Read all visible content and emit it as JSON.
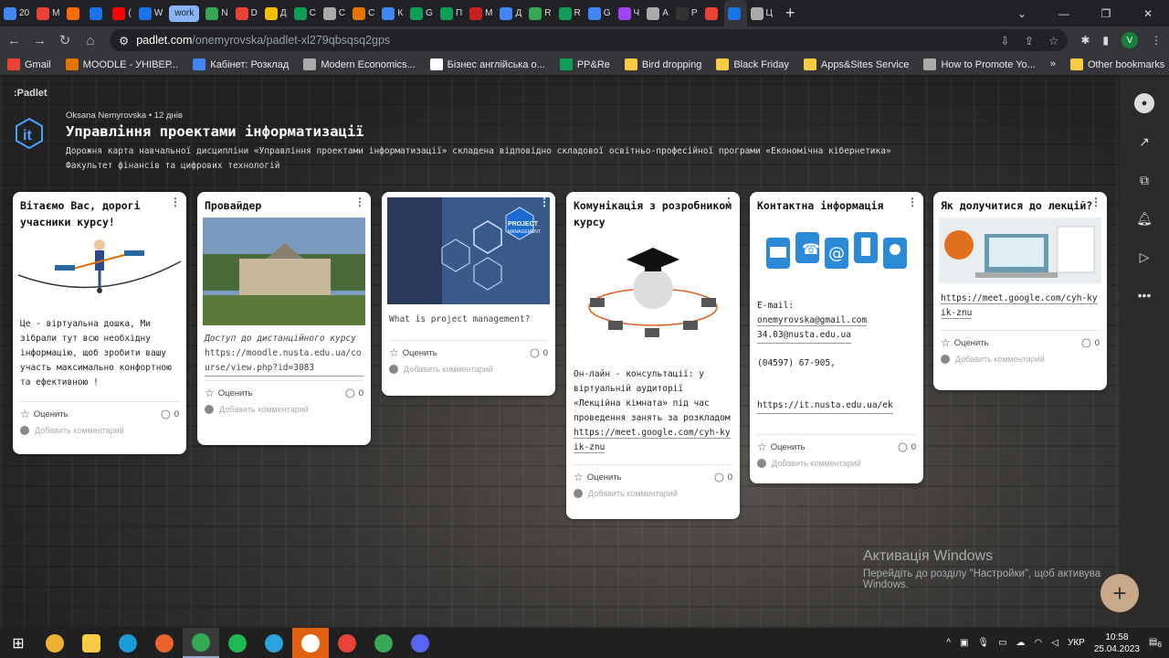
{
  "browser": {
    "tabs": [
      {
        "label": "20",
        "color": "#4285f4"
      },
      {
        "label": "M",
        "color": "#ea4335"
      },
      {
        "label": "",
        "color": "#ff6d00"
      },
      {
        "label": "",
        "color": "#1a73e8"
      },
      {
        "label": "(",
        "color": "#ff0000"
      },
      {
        "label": "W",
        "color": "#1a73e8"
      },
      {
        "label": "work",
        "color": "#8ab4f8"
      },
      {
        "label": "N",
        "color": "#34a853"
      },
      {
        "label": "D",
        "color": "#ea4335"
      },
      {
        "label": "Д",
        "color": "#fbbc04"
      },
      {
        "label": "С",
        "color": "#0f9d58"
      },
      {
        "label": "С",
        "color": "#aaaaaa"
      },
      {
        "label": "С",
        "color": "#e37400"
      },
      {
        "label": "К",
        "color": "#4285f4"
      },
      {
        "label": "G",
        "color": "#0f9d58"
      },
      {
        "label": "П",
        "color": "#0f9d58"
      },
      {
        "label": "М",
        "color": "#c5221f"
      },
      {
        "label": "Д",
        "color": "#4285f4"
      },
      {
        "label": "R",
        "color": "#34a853"
      },
      {
        "label": "R",
        "color": "#0f9d58"
      },
      {
        "label": "G",
        "color": "#4285f4"
      },
      {
        "label": "Ч",
        "color": "#a142f4"
      },
      {
        "label": "А",
        "color": "#aaaaaa"
      },
      {
        "label": "Р",
        "color": "#333333"
      },
      {
        "label": "",
        "color": "#ea4335"
      },
      {
        "label": "",
        "color": "#1a73e8"
      },
      {
        "label": "Ц",
        "color": "#aaaaaa"
      }
    ],
    "url_host": "padlet.com",
    "url_path": "/onemyrovska/padlet-xl279qbsqsq2gps",
    "profile_initial": "V",
    "bookmarks": [
      {
        "label": "Gmail",
        "color": "#ea4335"
      },
      {
        "label": "MOODLE - УНІВЕР...",
        "color": "#e37400"
      },
      {
        "label": "Кабінет: Розклад",
        "color": "#4285f4"
      },
      {
        "label": "Modern Economics...",
        "color": "#aaaaaa"
      },
      {
        "label": "Бізнес англійська о...",
        "color": "#ffffff"
      },
      {
        "label": "PP&Re",
        "color": "#0f9d58"
      },
      {
        "label": "Bird dropping",
        "color": "#f9cb45"
      },
      {
        "label": "Black Friday",
        "color": "#f9cb45"
      },
      {
        "label": "Apps&Sites Service",
        "color": "#f9cb45"
      },
      {
        "label": "How to Promote Yo...",
        "color": "#aaaaaa"
      }
    ],
    "bookmarks_more": "»",
    "other_bookmarks": "Other bookmarks"
  },
  "padlet": {
    "brand": ":Padlet",
    "author": "Oksana Nemyrovska",
    "age": "• 12 днів",
    "title": "Управління проектами інформатизації",
    "description_line1": "Дорожня карта навчальної дисципліни «Управління проектами інформатизації» складена відповідно складової освітньо-професійної програми «Економічна кібернетика»",
    "description_line2": "Факультет фінансів та цифрових технологій"
  },
  "cards": [
    {
      "title": "Вітаємо Вас, дорогі учасники курсу!",
      "body": "Це - віртуальна дошка, Ми зібрали тут всю необхідну інформацію, щоб зробити вашу участь максимально конфортною та ефективною !",
      "rate": "Оценить",
      "comments": "0",
      "add_comment": "Добавить комментарий"
    },
    {
      "title": "Провайдер",
      "caption": "Доступ до дистанційного курсу",
      "link": "https://moodle.nusta.edu.ua/course/view.php?id=3083",
      "rate": "Оценить",
      "comments": "0",
      "add_comment": "Добавить комментарий"
    },
    {
      "title": "",
      "caption": "What is project management?",
      "img_text1": "PROJECT",
      "img_text2": "MANAGEMENT",
      "rate": "Оценить",
      "comments": "0",
      "add_comment": "Добавить комментарий"
    },
    {
      "title": "Комунікація з розробником курсу",
      "body": "Он-лайн - консультації: у віртуальній аудиторії «Лекційна кімната» під час проведення занять за розкладом",
      "link": "https://meet.google.com/cyh-kyik-znu",
      "rate": "Оценить",
      "comments": "0",
      "add_comment": "Добавить комментарий"
    },
    {
      "title": "Контактна інформація",
      "email_label": "E-mail:",
      "email1": "onemyrovska@gmail.com",
      "email2": "34.03@nusta.edu.ua",
      "phone": "(04597) 67-905,",
      "link": "https://it.nusta.edu.ua/ek",
      "rate": "Оценить",
      "comments": "0",
      "add_comment": "Добавить комментарий"
    },
    {
      "title": "Як долучитися до лекцій?",
      "link": "https://meet.google.com/cyh-kyik-znu",
      "rate": "Оценить",
      "comments": "0",
      "add_comment": "Добавить комментарий"
    }
  ],
  "activation": {
    "line1": "Активація Windows",
    "line2": "Перейдіть до розділу \"Настройки\", щоб активува",
    "line3": "Windows."
  },
  "taskbar": {
    "lang": "УКР",
    "time": "10:58",
    "date": "25.04.2023",
    "notif": "6"
  }
}
